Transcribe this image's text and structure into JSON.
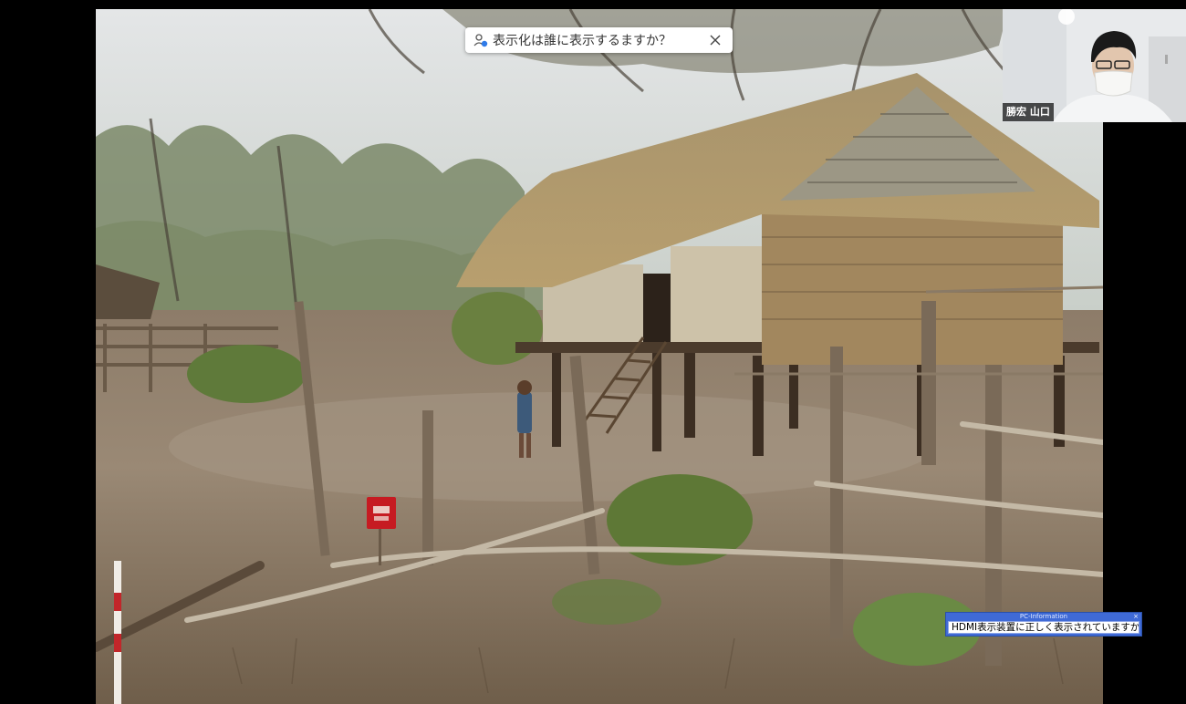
{
  "share_toast": {
    "text": "表示化は誰に表示するますか？",
    "icon": "person-share-icon",
    "close_icon": "close-icon"
  },
  "participant_video": {
    "name": "勝宏 山口"
  },
  "pc_information": {
    "title": "PC-Information",
    "message": "HDMI表示装置に正しく表示されていますか",
    "close_icon": "close-icon"
  },
  "shared_content": {
    "description_icon": "stilt-house-photo"
  },
  "colors": {
    "letterbox": "#000000",
    "pc_info_frame": "#3f6ad6",
    "toast_bg": "#ffffff",
    "sign_red": "#c61b22"
  }
}
